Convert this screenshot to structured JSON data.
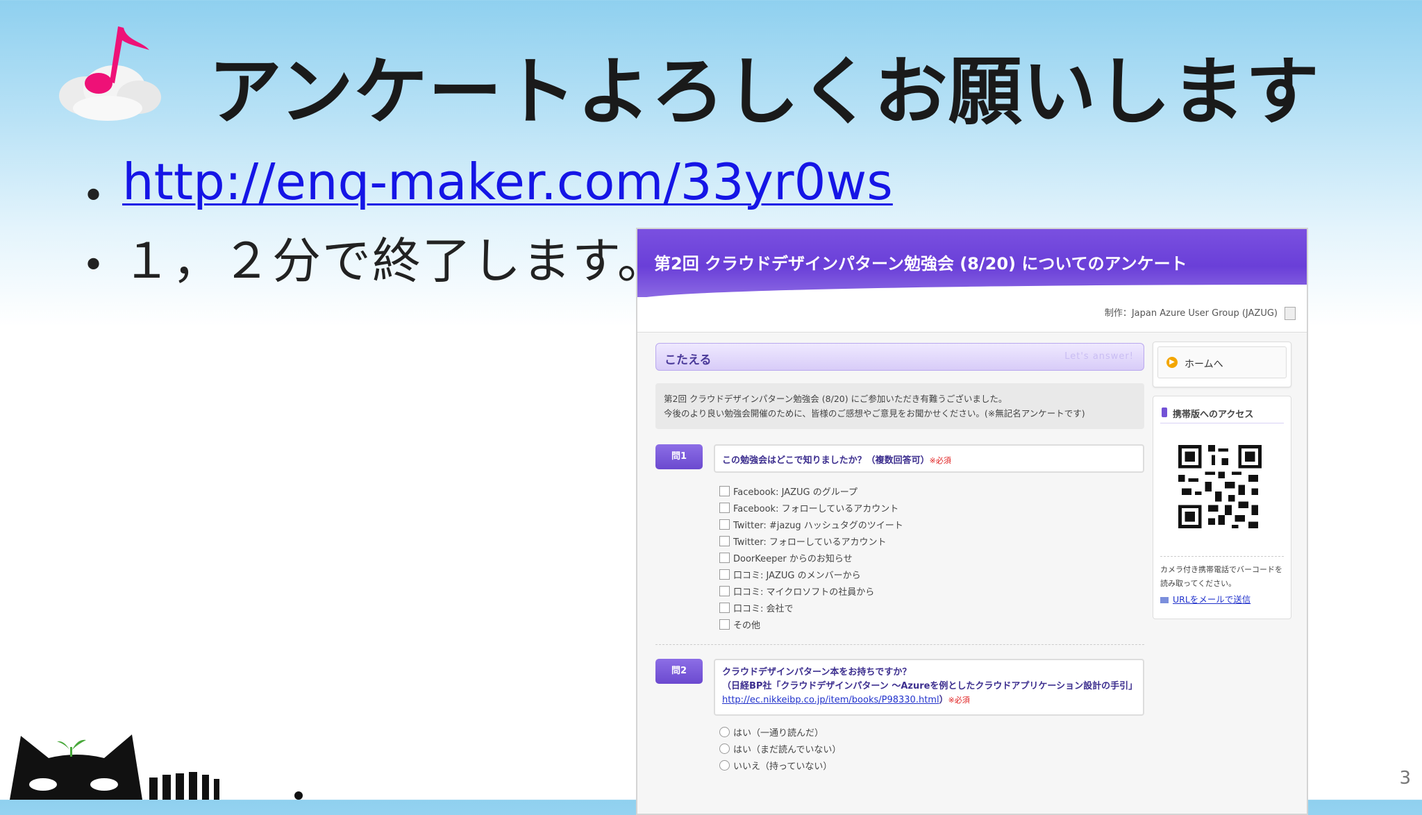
{
  "slide": {
    "title": "アンケートよろしくお願いします",
    "bullets": [
      {
        "text": "http://enq-maker.com/33yr0ws",
        "is_link": true
      },
      {
        "text": "１，２分で終了します。",
        "is_link": false
      }
    ],
    "page_number": "3"
  },
  "screenshot": {
    "survey_title": "第2回 クラウドデザインパターン勉強会 (8/20) についてのアンケート",
    "producer": "制作：Japan Azure User Group (JAZUG)",
    "answer_label": "こたえる",
    "answer_sub": "Let's answer!",
    "intro_lines": [
      "第2回 クラウドデザインパターン勉強会 (8/20) にご参加いただき有難うございました。",
      "今後のより良い勉強会開催のために、皆様のご感想やご意見をお聞かせください。(※無記名アンケートです)"
    ],
    "q1": {
      "badge": "問1",
      "question": "この勉強会はどこで知りましたか？（複数回答可）",
      "required": "※必須",
      "options": [
        "Facebook: JAZUG のグループ",
        "Facebook: フォローしているアカウント",
        "Twitter: #jazug ハッシュタグのツイート",
        "Twitter: フォローしているアカウント",
        "DoorKeeper からのお知らせ",
        "口コミ: JAZUG のメンバーから",
        "口コミ: マイクロソフトの社員から",
        "口コミ: 会社で",
        "その他"
      ]
    },
    "q2": {
      "badge": "問2",
      "line1": "クラウドデザインパターン本をお持ちですか？",
      "line2": "（日経BP社「クラウドデザインパターン ～Azureを例としたクラウドアプリケーション設計の手引」",
      "link": "http://ec.nikkeibp.co.jp/item/books/P98330.html",
      "link_suffix": "）",
      "required": "※必須",
      "options": [
        "はい（一通り読んだ）",
        "はい（まだ読んでいない）",
        "いいえ（持っていない）"
      ]
    },
    "sidebar": {
      "home_label": "ホームへ",
      "mobile_title": "携帯版へのアクセス",
      "mobile_desc": "カメラ付き携帯電話でバーコードを読み取ってください。",
      "mail_link": "URLをメールで送信"
    }
  },
  "colors": {
    "link_blue": "#1515e6",
    "survey_purple": "#6a3fd8",
    "required_red": "#e02020"
  }
}
